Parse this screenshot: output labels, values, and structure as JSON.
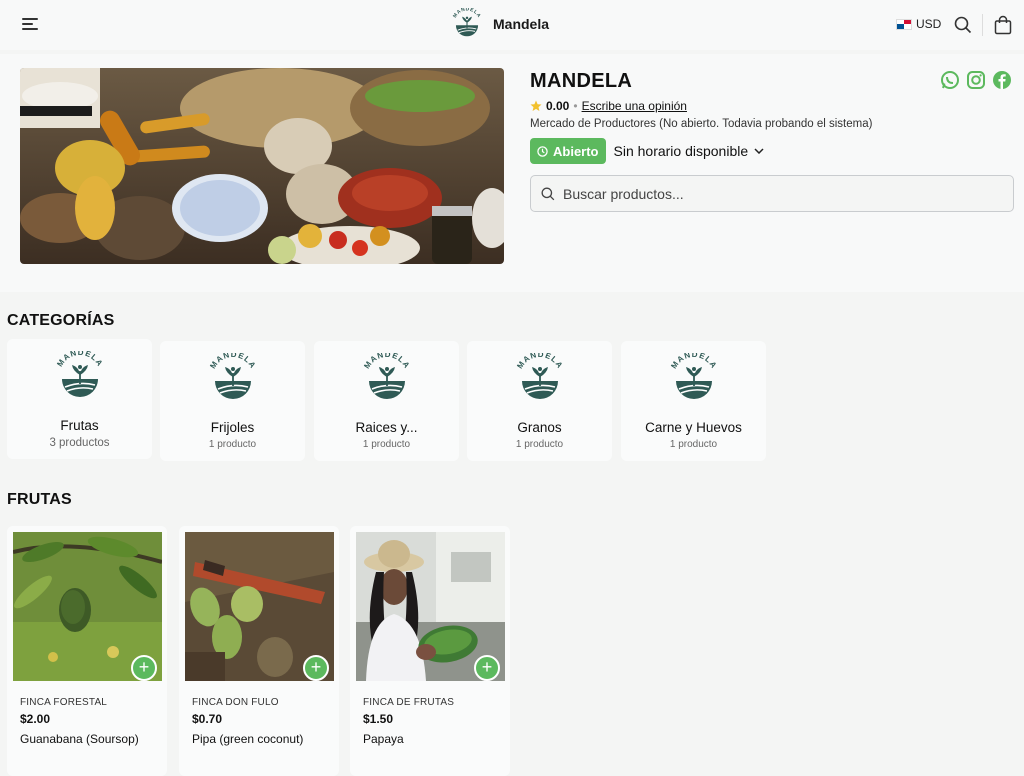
{
  "header": {
    "brand_name": "Mandela",
    "logo_text": "MANDELA",
    "currency": "USD"
  },
  "store": {
    "title": "MANDELA",
    "rating": "0.00",
    "review_link": "Escribe una opinión",
    "description": "Mercado de Productores (No abierto. Todavia probando el sistema)",
    "status": "Abierto",
    "schedule": "Sin horario disponible",
    "search_placeholder": "Buscar productos..."
  },
  "socials": [
    "whatsapp-icon",
    "instagram-icon",
    "facebook-icon"
  ],
  "colors": {
    "accent": "#5cb95e",
    "logo": "#2f5a55"
  },
  "categories_title": "CATEGORÍAS",
  "categories": [
    {
      "name": "Frutas",
      "count": "3 productos"
    },
    {
      "name": "Frijoles",
      "count": "1 producto"
    },
    {
      "name": "Raices y...",
      "count": "1 producto"
    },
    {
      "name": "Granos",
      "count": "1 producto"
    },
    {
      "name": "Carne y Huevos",
      "count": "1 producto"
    }
  ],
  "products_title": "FRUTAS",
  "products": [
    {
      "farm": "FINCA FORESTAL",
      "price": "$2.00",
      "name": "Guanabana (Soursop)"
    },
    {
      "farm": "FINCA DON FULO",
      "price": "$0.70",
      "name": "Pipa (green coconut)"
    },
    {
      "farm": "FINCA DE FRUTAS",
      "price": "$1.50",
      "name": "Papaya"
    }
  ],
  "add_label": "+"
}
